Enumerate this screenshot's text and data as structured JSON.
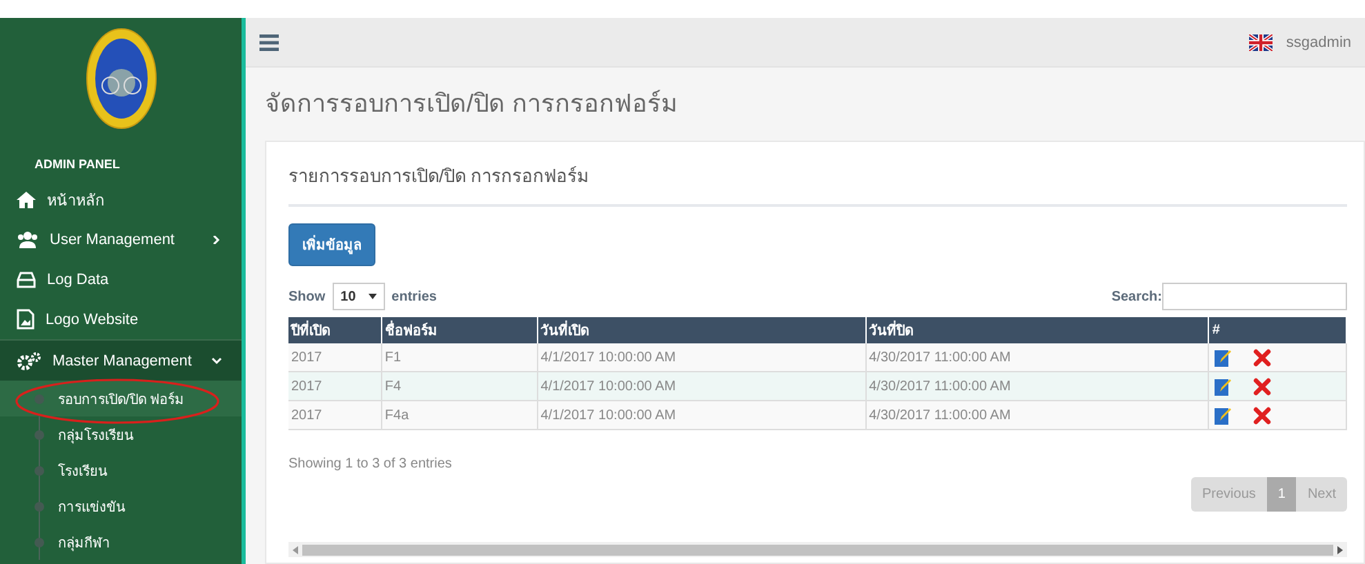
{
  "sidebar": {
    "heading": "ADMIN PANEL",
    "items": [
      {
        "label": "หน้าหลัก",
        "expandable": false,
        "expanded": false
      },
      {
        "label": "User Management",
        "expandable": true,
        "expanded": false
      },
      {
        "label": "Log Data",
        "expandable": false,
        "expanded": false
      },
      {
        "label": "Logo Website",
        "expandable": false,
        "expanded": false
      },
      {
        "label": "Master Management",
        "expandable": true,
        "expanded": true,
        "children": [
          {
            "label": "รอบการเปิด/ปิด ฟอร์ม",
            "selected": true
          },
          {
            "label": "กลุ่มโรงเรียน",
            "selected": false
          },
          {
            "label": "โรงเรียน",
            "selected": false
          },
          {
            "label": "การแข่งขัน",
            "selected": false
          },
          {
            "label": "กลุ่มกีฬา",
            "selected": false
          }
        ]
      }
    ]
  },
  "topbar": {
    "user": "ssgadmin"
  },
  "page_title": "จัดการรอบการเปิด/ปิด การกรอกฟอร์ม",
  "card": {
    "title": "รายการรอบการเปิด/ปิด การกรอกฟอร์ม",
    "add_button": "เพิ่มข้อมูล",
    "show_label": "Show",
    "page_size": "10",
    "entries_label": "entries",
    "search_label": "Search:",
    "table": {
      "columns": [
        "ปีที่เปิด",
        "ชื่อฟอร์ม",
        "วันที่เปิด",
        "วันที่ปิด",
        "#"
      ],
      "rows": [
        [
          "2017",
          "F1",
          "4/1/2017 10:00:00 AM",
          "4/30/2017 11:00:00 AM"
        ],
        [
          "2017",
          "F4",
          "4/1/2017 10:00:00 AM",
          "4/30/2017 11:00:00 AM"
        ],
        [
          "2017",
          "F4a",
          "4/1/2017 10:00:00 AM",
          "4/30/2017 11:00:00 AM"
        ]
      ]
    },
    "info": "Showing 1 to 3 of 3 entries",
    "pagination": {
      "previous": "Previous",
      "page": "1",
      "next": "Next"
    }
  }
}
